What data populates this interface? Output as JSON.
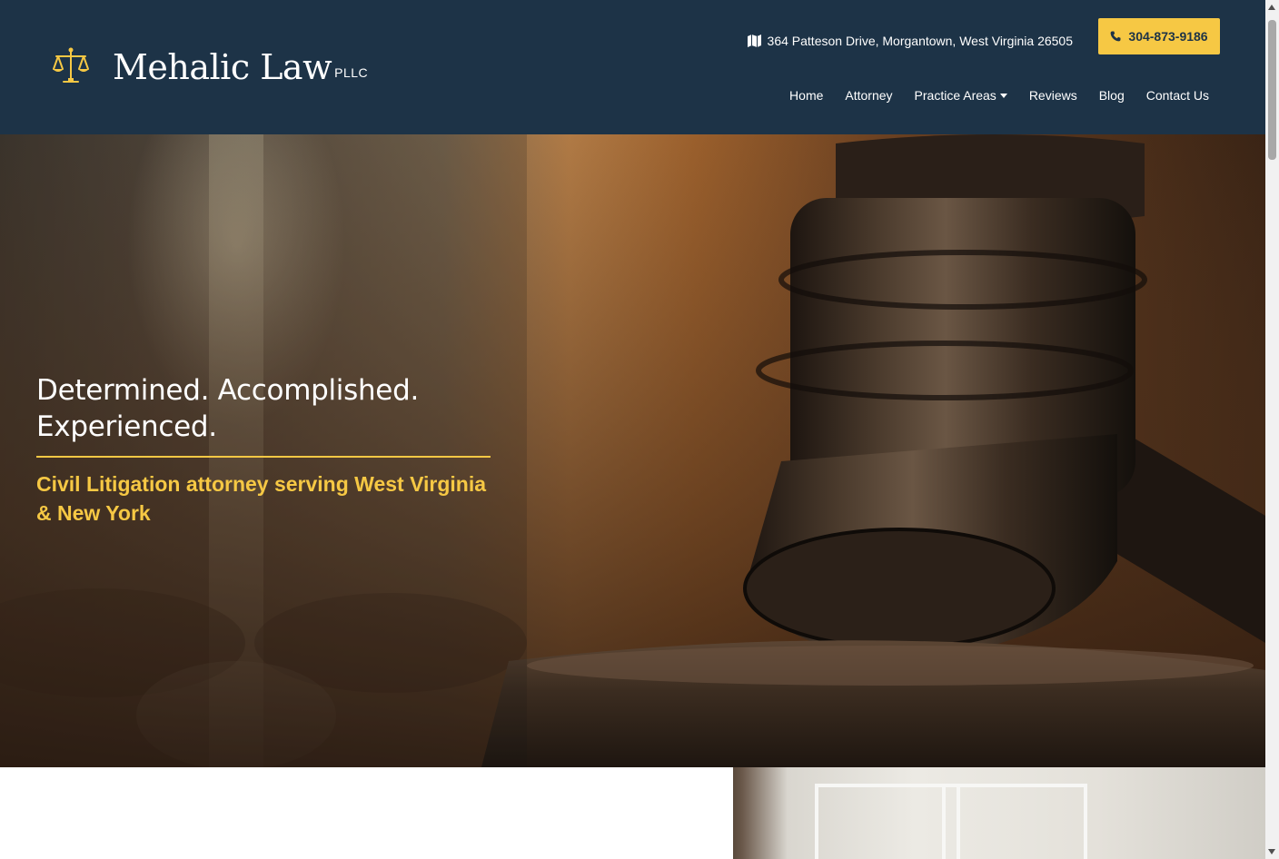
{
  "brand": {
    "name": "Mehalic Law",
    "suffix": "PLLC",
    "logo_icon": "scales-of-justice-icon",
    "accent_color": "#f6c844",
    "header_color": "#1d3347"
  },
  "contact": {
    "address_icon": "map-icon",
    "address": "364 Patteson Drive, Morgantown, West Virginia 26505",
    "phone_icon": "phone-icon",
    "phone": "304-873-9186"
  },
  "nav": {
    "items": [
      {
        "label": "Home"
      },
      {
        "label": "Attorney"
      },
      {
        "label": "Practice Areas",
        "has_dropdown": true
      },
      {
        "label": "Reviews"
      },
      {
        "label": "Blog"
      },
      {
        "label": "Contact Us"
      }
    ]
  },
  "hero": {
    "heading_line1": "Determined. Accomplished.",
    "heading_line2": "Experienced.",
    "subheading_line1": "Civil Litigation attorney serving West Virginia",
    "subheading_line2": "& New York"
  }
}
